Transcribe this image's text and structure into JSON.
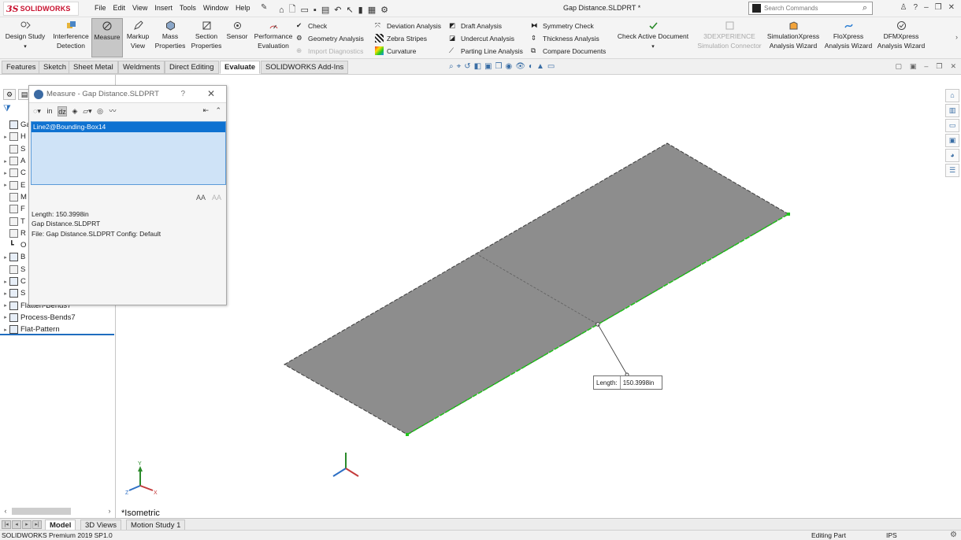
{
  "app": {
    "brand": "SOLIDWORKS",
    "document_title": "Gap Distance.SLDPRT *"
  },
  "menu": [
    "File",
    "Edit",
    "View",
    "Insert",
    "Tools",
    "Window",
    "Help"
  ],
  "search": {
    "placeholder": "Search Commands"
  },
  "ribbon": {
    "design_study": "Design Study",
    "interference_detection": "Interference Detection",
    "measure": "Measure",
    "markup_view": "Markup View",
    "mass_properties": "Mass Properties",
    "section_properties": "Section Properties",
    "sensor": "Sensor",
    "performance_evaluation": "Performance Evaluation",
    "check": "Check",
    "geometry_analysis": "Geometry Analysis",
    "import_diagnostics": "Import Diagnostics",
    "deviation_analysis": "Deviation Analysis",
    "zebra_stripes": "Zebra Stripes",
    "curvature": "Curvature",
    "draft_analysis": "Draft Analysis",
    "undercut_analysis": "Undercut Analysis",
    "parting_line_analysis": "Parting Line Analysis",
    "symmetry_check": "Symmetry Check",
    "thickness_analysis": "Thickness Analysis",
    "compare_documents": "Compare Documents",
    "check_active_document": "Check Active Document",
    "simulation_connector": "3DEXPERIENCE Simulation Connector",
    "simulationxpress": "SimulationXpress Analysis Wizard",
    "floxpress": "FloXpress Analysis Wizard",
    "dfmxpress": "DFMXpress Analysis Wizard"
  },
  "tabs": [
    "Features",
    "Sketch",
    "Sheet Metal",
    "Weldments",
    "Direct Editing",
    "Evaluate",
    "SOLIDWORKS Add-Ins"
  ],
  "active_tab": "Evaluate",
  "feature_tree": [
    {
      "label": "Gap"
    },
    {
      "label": "H"
    },
    {
      "label": "S"
    },
    {
      "label": "A"
    },
    {
      "label": "C"
    },
    {
      "label": "E"
    },
    {
      "label": "M"
    },
    {
      "label": "F"
    },
    {
      "label": "T"
    },
    {
      "label": "R"
    },
    {
      "label": "O"
    },
    {
      "label": "B"
    },
    {
      "label": "S"
    },
    {
      "label": "C"
    },
    {
      "label": "S"
    },
    {
      "label": "Flatten-Bends7"
    },
    {
      "label": "Process-Bends7"
    },
    {
      "label": "Flat-Pattern"
    }
  ],
  "measure_dialog": {
    "title": "Measure - Gap Distance.SLDPRT",
    "help": "?",
    "selection": "Line2@Bounding-Box14",
    "results": [
      "Length: 150.3998in",
      "Gap Distance.SLDPRT",
      "File: Gap Distance.SLDPRT Config: Default"
    ]
  },
  "callout": {
    "label": "Length:",
    "value": "150.3998in"
  },
  "view_name": "*Isometric",
  "bottom_tabs": [
    "Model",
    "3D Views",
    "Motion Study 1"
  ],
  "status": {
    "product": "SOLIDWORKS Premium 2019 SP1.0",
    "mode": "Editing Part",
    "units": "IPS"
  },
  "colors": {
    "brand_red": "#c8102e",
    "selection_blue": "#0f72d1",
    "edge_green": "#22c21c",
    "part_gray": "#8c8c8c"
  }
}
